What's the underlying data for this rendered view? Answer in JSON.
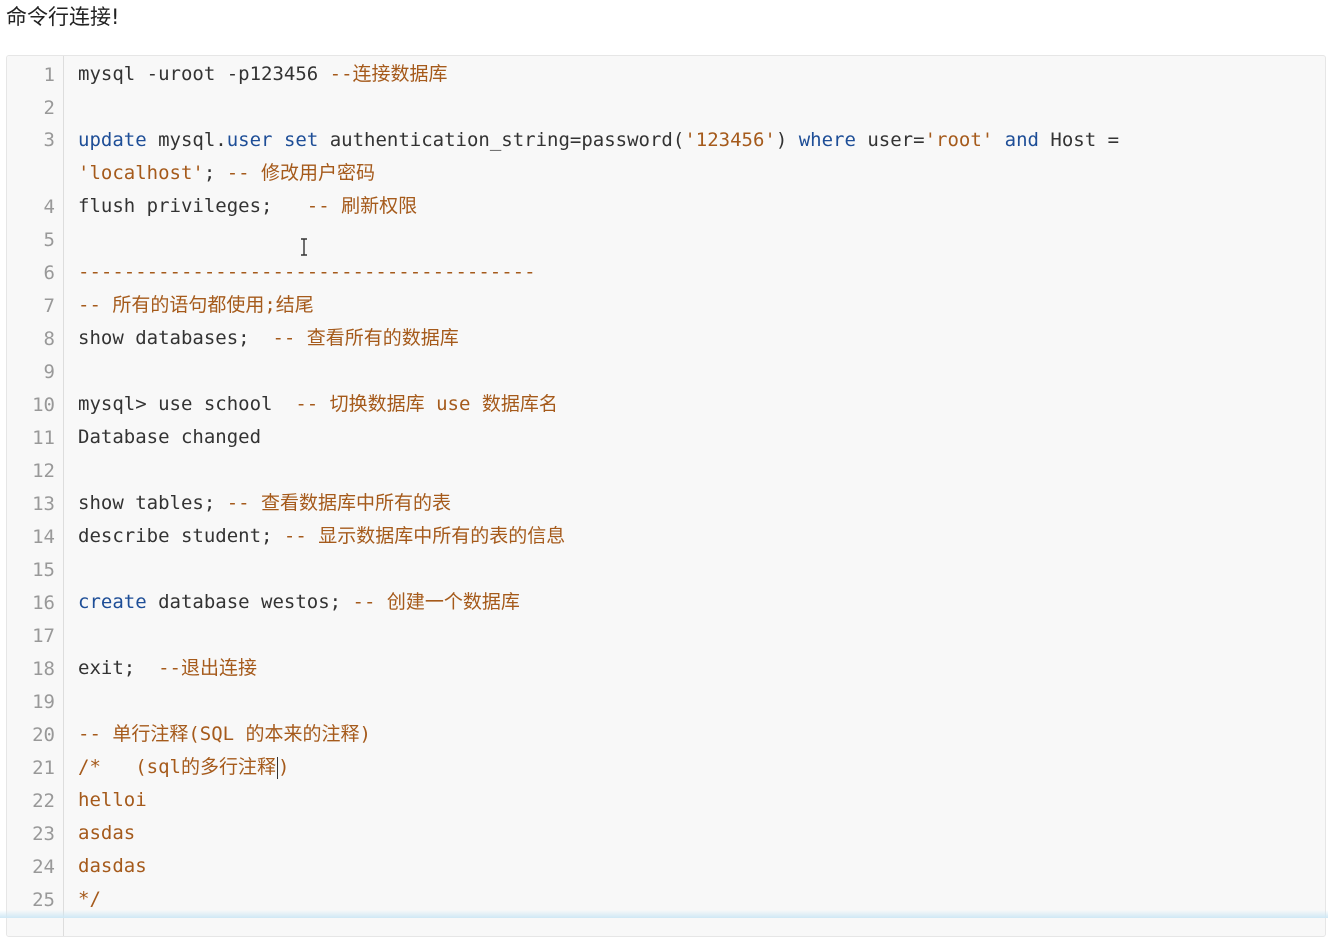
{
  "heading": "命令行连接!",
  "lines": [
    {
      "n": "1",
      "segs": [
        {
          "t": "mysql -uroot -p123456 ",
          "c": "txt"
        },
        {
          "t": "--连接数据库",
          "c": "cm"
        }
      ]
    },
    {
      "n": "2",
      "segs": []
    },
    {
      "n": "3",
      "segs": [
        {
          "t": "update",
          "c": "kw"
        },
        {
          "t": " mysql.",
          "c": "txt"
        },
        {
          "t": "user",
          "c": "kw"
        },
        {
          "t": " ",
          "c": "txt"
        },
        {
          "t": "set",
          "c": "kw"
        },
        {
          "t": " authentication_string=password(",
          "c": "txt"
        },
        {
          "t": "'123456'",
          "c": "str"
        },
        {
          "t": ") ",
          "c": "txt"
        },
        {
          "t": "where",
          "c": "kw"
        },
        {
          "t": " user=",
          "c": "txt"
        },
        {
          "t": "'root'",
          "c": "str"
        },
        {
          "t": " ",
          "c": "txt"
        },
        {
          "t": "and",
          "c": "kw"
        },
        {
          "t": " Host =",
          "c": "txt"
        }
      ],
      "cont": [
        {
          "t": "'localhost'",
          "c": "str"
        },
        {
          "t": "; ",
          "c": "txt"
        },
        {
          "t": "-- 修改用户密码",
          "c": "cm"
        }
      ]
    },
    {
      "n": "4",
      "segs": [
        {
          "t": "flush privileges;   ",
          "c": "txt"
        },
        {
          "t": "-- 刷新权限",
          "c": "cm"
        }
      ]
    },
    {
      "n": "5",
      "segs": []
    },
    {
      "n": "6",
      "segs": [
        {
          "t": "----------------------------------------",
          "c": "cm"
        }
      ]
    },
    {
      "n": "7",
      "segs": [
        {
          "t": "-- 所有的语句都使用;结尾",
          "c": "cm"
        }
      ]
    },
    {
      "n": "8",
      "segs": [
        {
          "t": "show databases;  ",
          "c": "txt"
        },
        {
          "t": "-- 查看所有的数据库",
          "c": "cm"
        }
      ]
    },
    {
      "n": "9",
      "segs": []
    },
    {
      "n": "10",
      "segs": [
        {
          "t": "mysql> use school  ",
          "c": "txt"
        },
        {
          "t": "-- 切换数据库 ",
          "c": "cm"
        },
        {
          "t": "use",
          "c": "str"
        },
        {
          "t": " 数据库名",
          "c": "cm"
        }
      ]
    },
    {
      "n": "11",
      "segs": [
        {
          "t": "Database changed",
          "c": "txt"
        }
      ]
    },
    {
      "n": "12",
      "segs": []
    },
    {
      "n": "13",
      "segs": [
        {
          "t": "show tables; ",
          "c": "txt"
        },
        {
          "t": "-- 查看数据库中所有的表",
          "c": "cm"
        }
      ]
    },
    {
      "n": "14",
      "segs": [
        {
          "t": "describe student; ",
          "c": "txt"
        },
        {
          "t": "-- 显示数据库中所有的表的信息",
          "c": "cm"
        }
      ]
    },
    {
      "n": "15",
      "segs": []
    },
    {
      "n": "16",
      "segs": [
        {
          "t": "create",
          "c": "kw"
        },
        {
          "t": " database westos; ",
          "c": "txt"
        },
        {
          "t": "-- 创建一个数据库",
          "c": "cm"
        }
      ]
    },
    {
      "n": "17",
      "segs": []
    },
    {
      "n": "18",
      "segs": [
        {
          "t": "exit;  ",
          "c": "txt"
        },
        {
          "t": "--退出连接",
          "c": "cm"
        }
      ]
    },
    {
      "n": "19",
      "segs": []
    },
    {
      "n": "20",
      "segs": [
        {
          "t": "-- 单行注释(SQL 的本来的注释)",
          "c": "cm"
        }
      ]
    },
    {
      "n": "21",
      "segs": [
        {
          "t": "/*   (sql的多行注释",
          "c": "cm"
        },
        {
          "t": "",
          "c": "caret"
        },
        {
          "t": ")",
          "c": "cm"
        }
      ]
    },
    {
      "n": "22",
      "segs": [
        {
          "t": "helloi",
          "c": "cm"
        }
      ]
    },
    {
      "n": "23",
      "segs": [
        {
          "t": "asdas",
          "c": "cm"
        }
      ]
    },
    {
      "n": "24",
      "segs": [
        {
          "t": "dasdas",
          "c": "cm"
        }
      ]
    },
    {
      "n": "25",
      "segs": [
        {
          "t": "*/",
          "c": "cm"
        }
      ]
    }
  ]
}
